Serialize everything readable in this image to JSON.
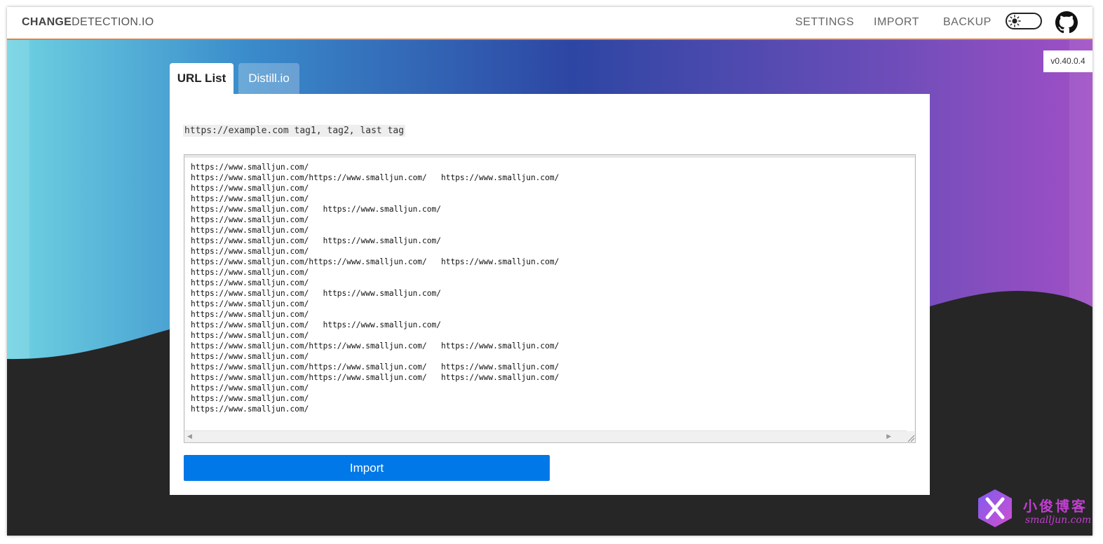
{
  "header": {
    "brand_bold": "CHANGE",
    "brand_rest": "DETECTION.IO",
    "nav": {
      "settings": "SETTINGS",
      "import": "IMPORT",
      "backup": "BACKUP"
    },
    "icons": {
      "theme_toggle": "sun-icon",
      "github": "github-icon"
    }
  },
  "version": "v0.40.0.4",
  "tabs": [
    {
      "label": "URL List",
      "active": true
    },
    {
      "label": "Distill.io",
      "active": false
    }
  ],
  "import_form": {
    "format_hint": "https://example.com tag1, tag2, last tag",
    "textarea_value": "https://www.smalljun.com/\nhttps://www.smalljun.com/https://www.smalljun.com/   https://www.smalljun.com/\nhttps://www.smalljun.com/\nhttps://www.smalljun.com/\nhttps://www.smalljun.com/   https://www.smalljun.com/\nhttps://www.smalljun.com/\nhttps://www.smalljun.com/\nhttps://www.smalljun.com/   https://www.smalljun.com/\nhttps://www.smalljun.com/\nhttps://www.smalljun.com/https://www.smalljun.com/   https://www.smalljun.com/\nhttps://www.smalljun.com/\nhttps://www.smalljun.com/\nhttps://www.smalljun.com/   https://www.smalljun.com/\nhttps://www.smalljun.com/\nhttps://www.smalljun.com/\nhttps://www.smalljun.com/   https://www.smalljun.com/\nhttps://www.smalljun.com/\nhttps://www.smalljun.com/https://www.smalljun.com/   https://www.smalljun.com/\nhttps://www.smalljun.com/\nhttps://www.smalljun.com/https://www.smalljun.com/   https://www.smalljun.com/\nhttps://www.smalljun.com/https://www.smalljun.com/   https://www.smalljun.com/\nhttps://www.smalljun.com/\nhttps://www.smalljun.com/\nhttps://www.smalljun.com/",
    "submit_label": "Import"
  },
  "watermark": {
    "cn": "小俊博客",
    "en": "smalljun.com"
  },
  "colors": {
    "accent_line": "#e0823e",
    "button": "#0078e7",
    "gradient": [
      "#6fd3e2",
      "#2b4aa8",
      "#9b4fc2"
    ],
    "dark_wave": "#262626"
  }
}
